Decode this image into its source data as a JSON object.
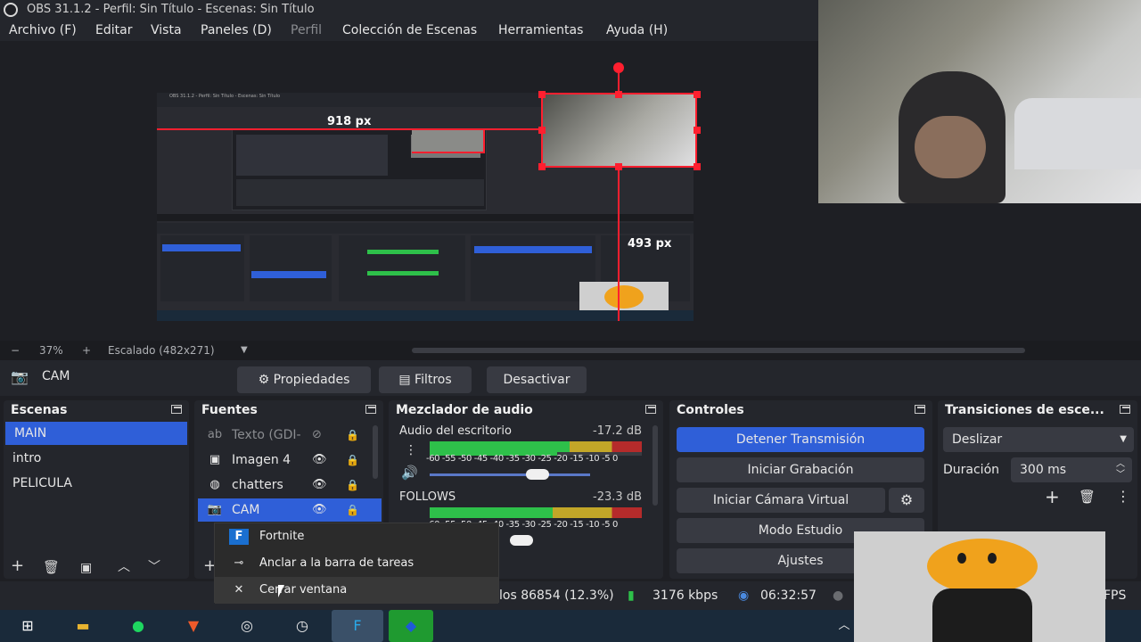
{
  "window": {
    "title": "OBS 31.1.2 - Perfil: Sin Título - Escenas: Sin Título"
  },
  "menu": [
    "Archivo (F)",
    "Editar",
    "Vista",
    "Paneles (D)",
    "Perfil",
    "Colección de Escenas",
    "Herramientas",
    "Ayuda (H)"
  ],
  "preview": {
    "nested_title": "OBS 31.1.2 - Perfil: Sin Título - Escenas: Sin Título",
    "label_width": "918 px",
    "label_height": "493 px"
  },
  "zoom": {
    "minus": "−",
    "level": "37%",
    "plus": "+",
    "scaling": "Escalado (482x271)"
  },
  "source_toolbar": {
    "selected": "CAM",
    "properties": "Propiedades",
    "filters": "Filtros",
    "deactivate": "Desactivar"
  },
  "scenes": {
    "title": "Escenas",
    "items": [
      "MAIN",
      "intro",
      "PELICULA"
    ]
  },
  "sources": {
    "title": "Fuentes",
    "items": [
      "Texto (GDI-",
      "Imagen 4",
      "chatters",
      "CAM"
    ]
  },
  "mixer": {
    "title": "Mezclador de audio",
    "channels": [
      {
        "name": "Audio del escritorio",
        "db": "-17.2 dB"
      },
      {
        "name": "FOLLOWS",
        "db": "-23.3 dB"
      }
    ],
    "scale": "-60 -55 -50 -45 -40 -35 -30 -25 -20 -15 -10 -5 0"
  },
  "controls": {
    "title": "Controles",
    "stop_stream": "Detener Transmisión",
    "start_recording": "Iniciar Grabación",
    "start_virtual_cam": "Iniciar Cámara Virtual",
    "studio_mode": "Modo Estudio",
    "settings": "Ajustes"
  },
  "transitions": {
    "title": "Transiciones de esce...",
    "selected": "Deslizar",
    "duration_label": "Duración",
    "duration_value": "300 ms"
  },
  "statusbar": {
    "frames": "los 86854 (12.3%)",
    "bitrate": "3176 kbps",
    "time": "06:32:57",
    "fps": "FPS"
  },
  "context_menu": {
    "items": [
      "Fortnite",
      "Anclar a la barra de tareas",
      "Cerrar ventana"
    ]
  },
  "colors": {
    "accent": "#2f5fd8",
    "red": "#ff1f2f",
    "panel": "#24262c",
    "bg": "#1e1f24"
  }
}
